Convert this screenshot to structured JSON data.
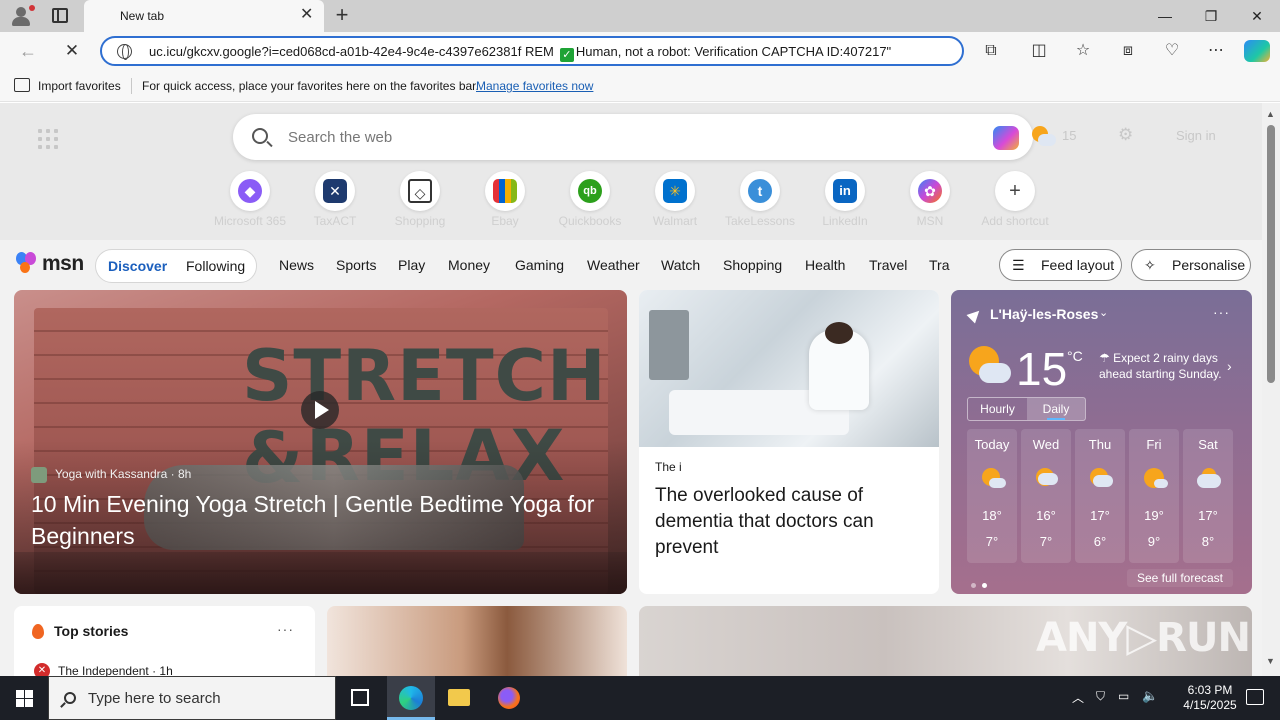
{
  "browser": {
    "tab_title": "New tab",
    "url_part1": "uc.icu/gkcxv.google?i=ced068cd-a01b-42e4-9c4e-c4397e62381f REM",
    "url_part2": "Human, not a robot: Verification CAPTCHA ID:407217\"",
    "favorites": {
      "import_label": "Import favorites",
      "message": "For quick access, place your favorites here on the favorites bar.",
      "manage_link": "Manage favorites now"
    }
  },
  "newtab": {
    "search_placeholder": "Search the web",
    "temp_top": "15",
    "sign_in": "Sign in",
    "shortcuts": [
      {
        "label": "Microsoft 365",
        "glyph": "◆",
        "color": "#8a5cf6"
      },
      {
        "label": "TaxACT",
        "glyph": "✕",
        "color": "#1e3a6e"
      },
      {
        "label": "Shopping",
        "glyph": "◇",
        "color": "#ffffff"
      },
      {
        "label": "Ebay",
        "glyph": "▣",
        "color": "#e53238"
      },
      {
        "label": "Quickbooks",
        "glyph": "qb",
        "color": "#2ca01c"
      },
      {
        "label": "Walmart",
        "glyph": "✳",
        "color": "#0071ce"
      },
      {
        "label": "TakeLessons",
        "glyph": "t",
        "color": "#3a8fd9"
      },
      {
        "label": "LinkedIn",
        "glyph": "in",
        "color": "#0a66c2"
      },
      {
        "label": "MSN",
        "glyph": "✿",
        "color": "#c94ad8"
      },
      {
        "label": "Add shortcut",
        "glyph": "+",
        "color": "#ffffff"
      }
    ]
  },
  "msn": {
    "logo_text": "msn",
    "feed_tabs": {
      "discover": "Discover",
      "following": "Following"
    },
    "categories": [
      "News",
      "Sports",
      "Play",
      "Money",
      "Gaming",
      "Weather",
      "Watch",
      "Shopping",
      "Health",
      "Travel",
      "Tra"
    ],
    "feed_layout": "Feed layout",
    "personalise": "Personalise"
  },
  "hero": {
    "overlay_line1": "STRETCH &",
    "overlay_line2": "RELAX",
    "source": "Yoga with Kassandra · 8h",
    "headline": "10 Min Evening Yoga Stretch | Gentle Bedtime Yoga for Beginners"
  },
  "mid_card": {
    "source": "The i",
    "headline": "The overlooked cause of dementia that doctors can prevent"
  },
  "weather": {
    "location": "L'Haÿ-les-Roses",
    "temperature": "15",
    "unit": "°C",
    "alert": "Expect 2 rainy days ahead starting Sunday.",
    "toggle_hourly": "Hourly",
    "toggle_daily": "Daily",
    "days": [
      {
        "name": "Today",
        "hi": "18°",
        "lo": "7°"
      },
      {
        "name": "Wed",
        "hi": "16°",
        "lo": "7°"
      },
      {
        "name": "Thu",
        "hi": "17°",
        "lo": "6°"
      },
      {
        "name": "Fri",
        "hi": "19°",
        "lo": "9°"
      },
      {
        "name": "Sat",
        "hi": "17°",
        "lo": "8°"
      }
    ],
    "forecast_link": "See full forecast"
  },
  "top_stories": {
    "title": "Top stories",
    "source": "The Independent · 1h"
  },
  "taskbar": {
    "search_placeholder": "Type here to search",
    "time": "6:03 PM",
    "date": "4/15/2025"
  }
}
